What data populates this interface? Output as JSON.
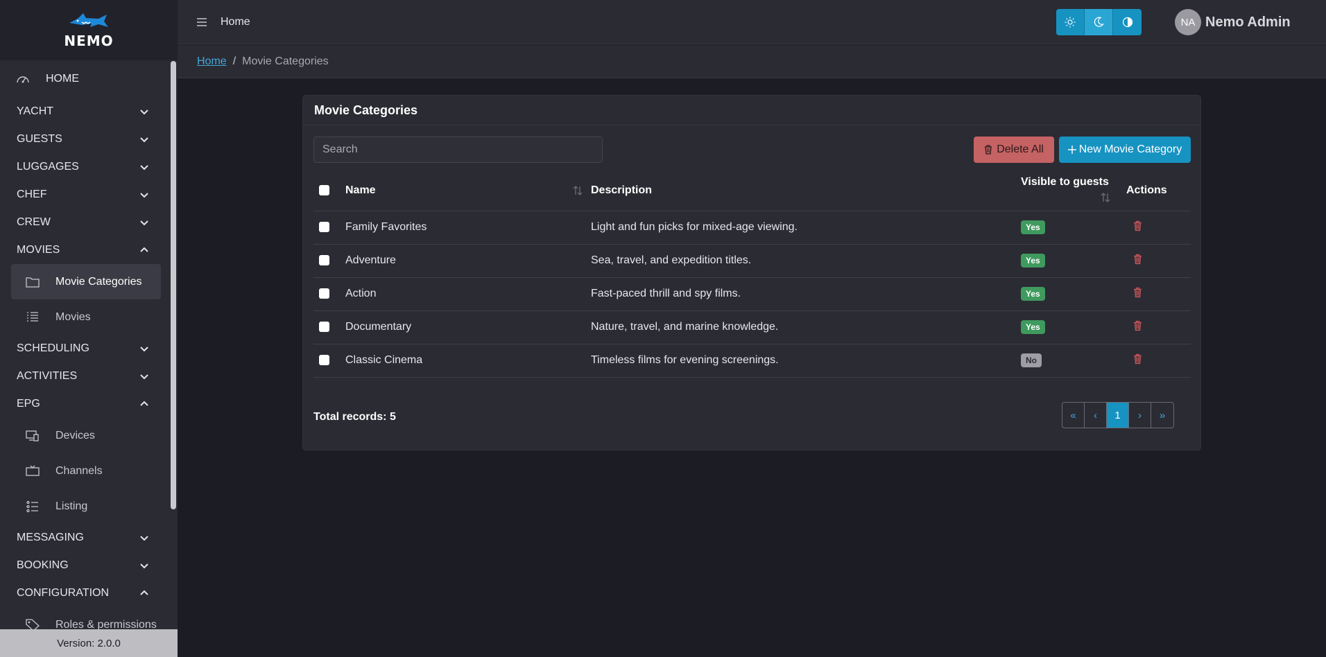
{
  "brand": {
    "logo_text": "NEMO",
    "version": "Version: 2.0.0"
  },
  "sidebar": {
    "home": "HOME",
    "sections": [
      {
        "label": "YACHT",
        "expanded": false
      },
      {
        "label": "GUESTS",
        "expanded": false
      },
      {
        "label": "LUGGAGES",
        "expanded": false
      },
      {
        "label": "CHEF",
        "expanded": false
      },
      {
        "label": "CREW",
        "expanded": false
      },
      {
        "label": "MOVIES",
        "expanded": true
      },
      {
        "label": "SCHEDULING",
        "expanded": false
      },
      {
        "label": "ACTIVITIES",
        "expanded": false
      },
      {
        "label": "EPG",
        "expanded": true
      },
      {
        "label": "MESSAGING",
        "expanded": false
      },
      {
        "label": "BOOKING",
        "expanded": false
      },
      {
        "label": "CONFIGURATION",
        "expanded": true
      }
    ],
    "movies_sub": [
      {
        "label": "Movie Categories",
        "icon": "folder-icon",
        "active": true
      },
      {
        "label": "Movies",
        "icon": "list-icon",
        "active": false
      }
    ],
    "epg_sub": [
      {
        "label": "Devices",
        "icon": "devices-icon"
      },
      {
        "label": "Channels",
        "icon": "tv-icon"
      },
      {
        "label": "Listing",
        "icon": "listing-icon"
      }
    ],
    "config_sub": [
      {
        "label": "Roles & permissions",
        "icon": "tag-icon"
      }
    ]
  },
  "topbar": {
    "title": "Home",
    "user_initials": "NA",
    "user_name": "Nemo Admin",
    "theme_active": "dark"
  },
  "breadcrumb": {
    "home": "Home",
    "separator": "/",
    "current": "Movie Categories"
  },
  "card": {
    "title": "Movie Categories",
    "search_placeholder": "Search",
    "delete_all": "Delete All",
    "new_button": "New Movie Category",
    "columns": {
      "name": "Name",
      "description": "Description",
      "visible": "Visible to guests",
      "actions": "Actions"
    },
    "rows": [
      {
        "name": "Family Favorites",
        "description": "Light and fun picks for mixed-age viewing.",
        "visible": "Yes"
      },
      {
        "name": "Adventure",
        "description": "Sea, travel, and expedition titles.",
        "visible": "Yes"
      },
      {
        "name": "Action",
        "description": "Fast-paced thrill and spy films.",
        "visible": "Yes"
      },
      {
        "name": "Documentary",
        "description": "Nature, travel, and marine knowledge.",
        "visible": "Yes"
      },
      {
        "name": "Classic Cinema",
        "description": "Timeless films for evening screenings.",
        "visible": "No"
      }
    ],
    "total": "Total records: 5",
    "pager": {
      "first": "«",
      "prev": "‹",
      "current": "1",
      "next": "›",
      "last": "»"
    }
  },
  "colors": {
    "accent": "#1793c2",
    "danger": "#e06c6c",
    "success": "#3f9a5e",
    "bg": "#1c1c25",
    "panel": "#2b2b34"
  }
}
